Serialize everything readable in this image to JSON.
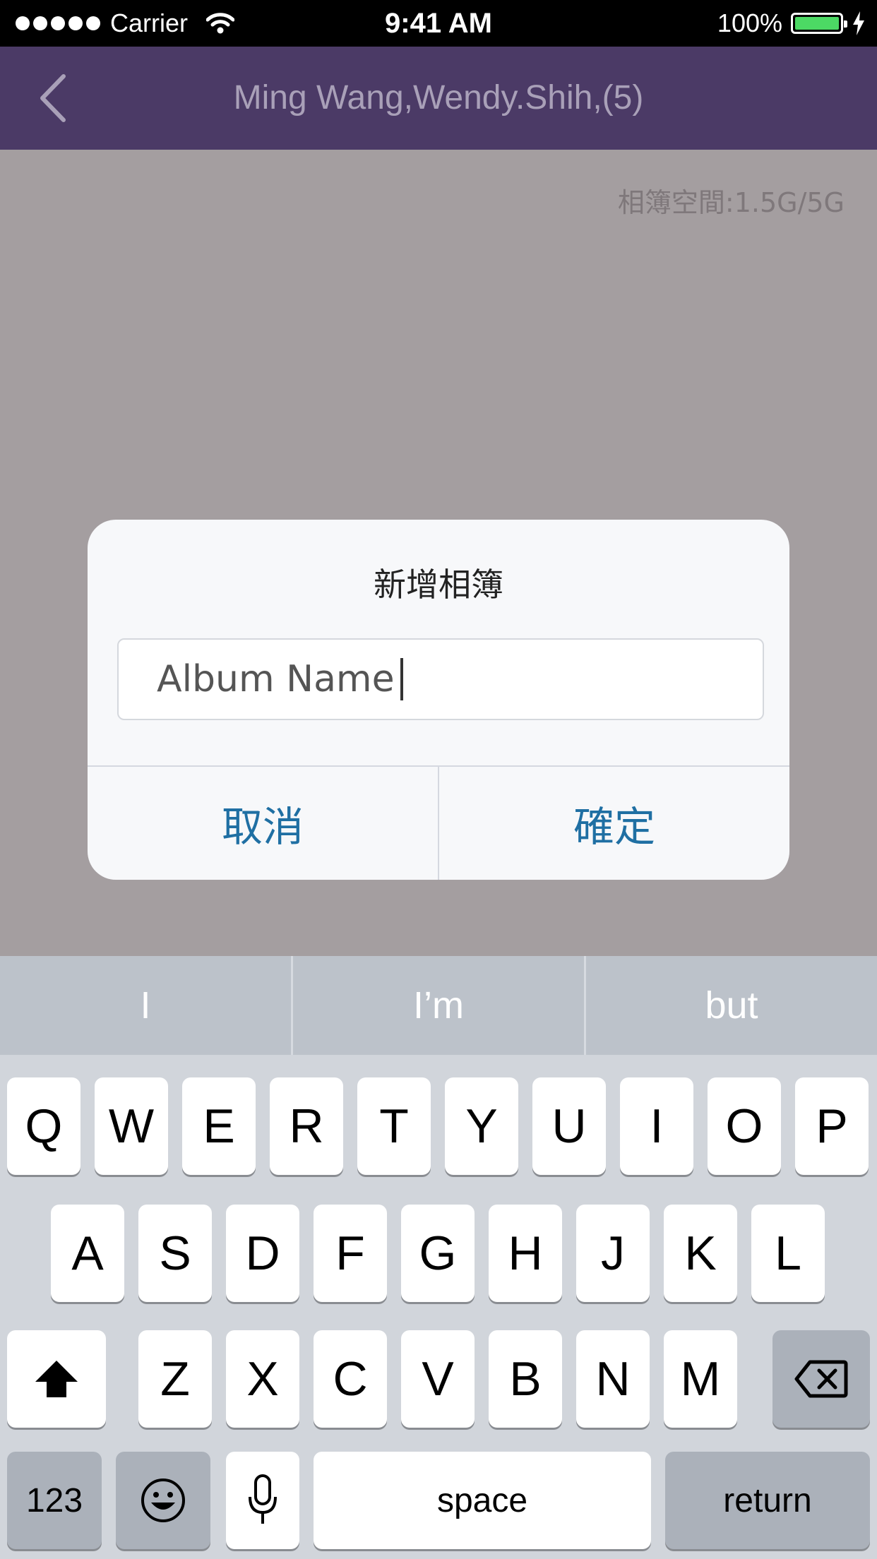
{
  "status_bar": {
    "carrier": "Carrier",
    "time": "9:41 AM",
    "battery": "100%",
    "battery_color": "#4cd964"
  },
  "nav": {
    "title": "Ming Wang,Wendy.Shih,(5)",
    "back_icon": "chevron-left-icon",
    "background": "#4b3a66"
  },
  "content": {
    "storage_label": "相簿空間:1.5G/5G"
  },
  "alert": {
    "title": "新增相簿",
    "input_value": "Album Name",
    "cancel_label": "取消",
    "confirm_label": "確定",
    "button_color": "#1f6fa3"
  },
  "keyboard": {
    "suggestions": [
      "I",
      "I’m",
      "but"
    ],
    "row1": [
      "Q",
      "W",
      "E",
      "R",
      "T",
      "Y",
      "U",
      "I",
      "O",
      "P"
    ],
    "row2": [
      "A",
      "S",
      "D",
      "F",
      "G",
      "H",
      "J",
      "K",
      "L"
    ],
    "row3": [
      "Z",
      "X",
      "C",
      "V",
      "B",
      "N",
      "M"
    ],
    "shift_icon": "shift-arrow-icon",
    "delete_icon": "backspace-icon",
    "numbers_label": "123",
    "emoji_icon": "emoji-icon",
    "mic_icon": "microphone-icon",
    "space_label": "space",
    "return_label": "return"
  }
}
